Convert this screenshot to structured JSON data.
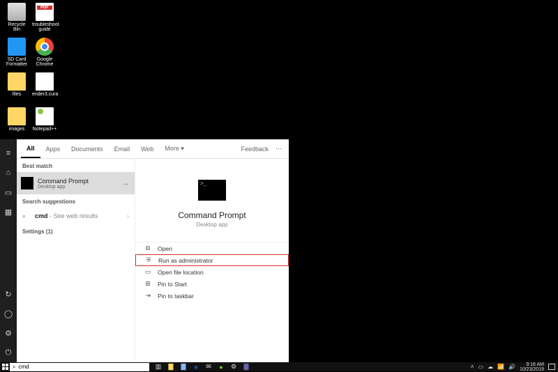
{
  "desktop": {
    "icons": [
      {
        "label": "Recycle Bin",
        "cls": "recycle"
      },
      {
        "label": "troubleshoot guide",
        "cls": "pdf"
      },
      {
        "label": "SD Card Formatter",
        "cls": "sd"
      },
      {
        "label": "Google Chrome",
        "cls": "chrome"
      },
      {
        "label": "files",
        "cls": "folder"
      },
      {
        "label": "ender3.cura",
        "cls": "file"
      },
      {
        "label": "images",
        "cls": "folder"
      },
      {
        "label": "Notepad++",
        "cls": "npp"
      }
    ]
  },
  "start": {
    "tabs": [
      "All",
      "Apps",
      "Documents",
      "Email",
      "Web",
      "More ▾"
    ],
    "feedback": "Feedback",
    "best_match_hdr": "Best match",
    "result_title": "Command Prompt",
    "result_sub": "Desktop app",
    "suggestions_hdr": "Search suggestions",
    "suggestion_text": "cmd",
    "suggestion_hint": " - See web results",
    "settings_hdr": "Settings (1)",
    "preview_title": "Command Prompt",
    "preview_sub": "Desktop app",
    "actions": [
      {
        "icon": "⧉",
        "label": "Open",
        "hl": false
      },
      {
        "icon": "⛨",
        "label": "Run as administrator",
        "hl": true
      },
      {
        "icon": "▭",
        "label": "Open file location",
        "hl": false
      },
      {
        "icon": "⊞",
        "label": "Pin to Start",
        "hl": false
      },
      {
        "icon": "⇥",
        "label": "Pin to taskbar",
        "hl": false
      }
    ]
  },
  "taskbar": {
    "search_value": "cmd",
    "time": "9:16 AM",
    "date": "10/23/2019"
  }
}
